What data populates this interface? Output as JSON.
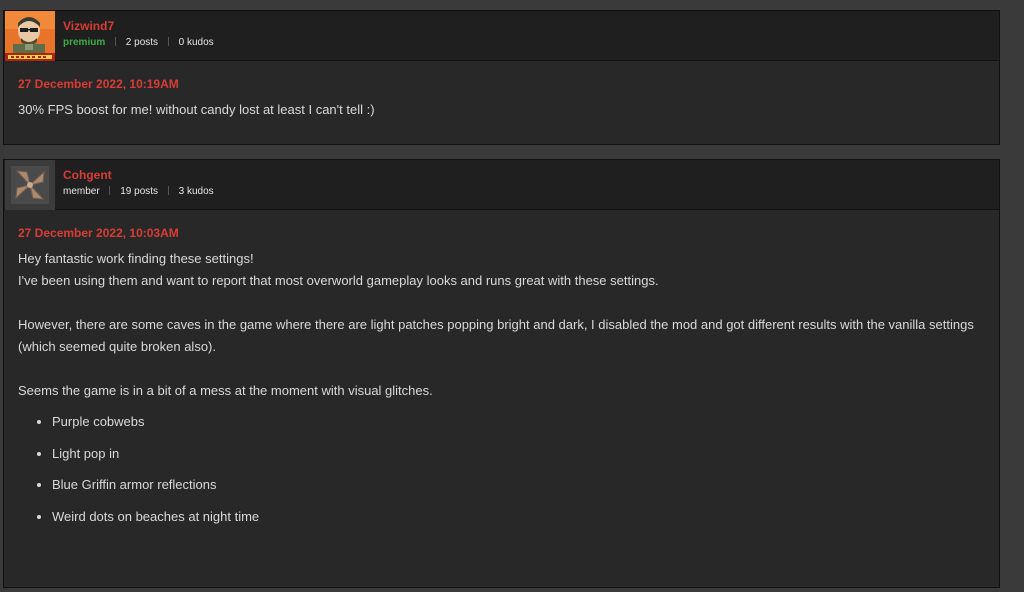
{
  "comments": [
    {
      "author": "Vizwind7",
      "role": "premium",
      "posts": "2 posts",
      "kudos": "0 kudos",
      "avatar_icon": "half-life-character-avatar",
      "date": "27 December 2022, 10:19AM",
      "body": [
        "30% FPS boost for me! without candy lost at least I can't tell :)"
      ]
    },
    {
      "author": "Cohgent",
      "role": "member",
      "posts": "19 posts",
      "kudos": "3 kudos",
      "avatar_icon": "default-pinwheel-avatar",
      "date": "27 December 2022, 10:03AM",
      "body": [
        "Hey fantastic work finding these settings!",
        "I've been using them and want to report that most overworld gameplay looks and runs great with these settings.",
        "However, there are some caves in the game where there are light patches popping bright and dark, I disabled the mod and got different results with the vanilla settings (which seemed quite broken also).",
        "Seems the game is in a bit of a mess at the moment with visual glitches."
      ],
      "list": [
        "Purple cobwebs",
        "Light pop in",
        "Blue Griffin armor reflections",
        "Weird dots on beaches at night time"
      ]
    }
  ],
  "colors": {
    "page_bg": "#3a3a3a",
    "card_bg": "#282828",
    "header_bg": "#1f1f1f",
    "accent_red": "#d93c35",
    "premium_green": "#3fae49",
    "body_text": "#d9d9d9"
  }
}
